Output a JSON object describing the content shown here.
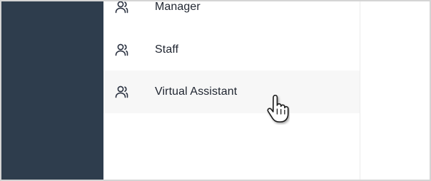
{
  "menu": {
    "items": [
      {
        "label": "Manager",
        "icon": "users-icon",
        "hovered": false
      },
      {
        "label": "Staff",
        "icon": "users-icon",
        "hovered": false
      },
      {
        "label": "Virtual Assistant",
        "icon": "users-icon",
        "hovered": true
      }
    ]
  },
  "colors": {
    "sidebar": "#2e3d4d",
    "hover_background": "#f7f7f7",
    "text": "#1f2530",
    "icon": "#2a3140"
  },
  "cursor": {
    "icon": "hand-pointer-icon"
  }
}
